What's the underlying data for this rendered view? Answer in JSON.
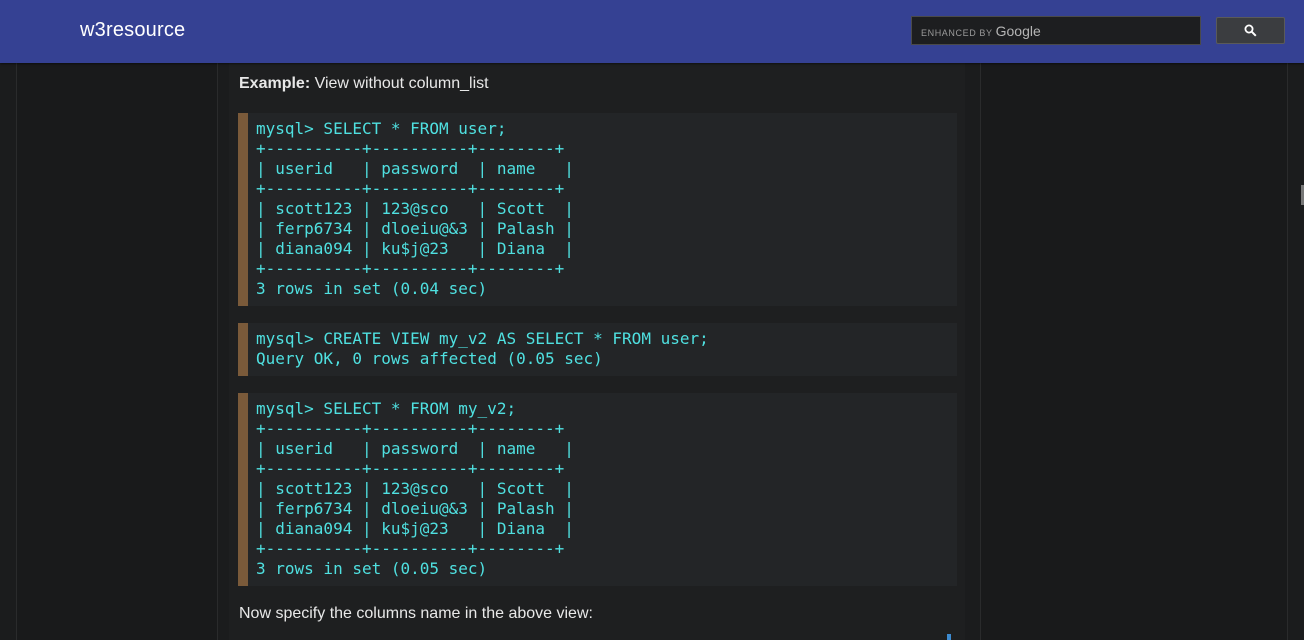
{
  "header": {
    "brand": "w3resource",
    "search": {
      "enhanced_label": "ENHANCED BY",
      "google_label": "Google",
      "value": ""
    }
  },
  "content": {
    "example_label": "Example:",
    "example_text": " View without column_list",
    "blocks": [
      {
        "lines": [
          "mysql> SELECT * FROM user;",
          "+----------+----------+--------+",
          "| userid   | password  | name   |",
          "+----------+----------+--------+",
          "| scott123 | 123@sco   | Scott  |",
          "| ferp6734 | dloeiu@&3 | Palash |",
          "| diana094 | ku$j@23   | Diana  |",
          "+----------+----------+--------+",
          "3 rows in set (0.04 sec)"
        ]
      },
      {
        "lines": [
          "mysql> CREATE VIEW my_v2 AS SELECT * FROM user;",
          "Query OK, 0 rows affected (0.05 sec)"
        ]
      },
      {
        "lines": [
          "mysql> SELECT * FROM my_v2;",
          "+----------+----------+--------+",
          "| userid   | password  | name   |",
          "+----------+----------+--------+",
          "| scott123 | 123@sco   | Scott  |",
          "| ferp6734 | dloeiu@&3 | Palash |",
          "| diana094 | ku$j@23   | Diana  |",
          "+----------+----------+--------+",
          "3 rows in set (0.05 sec)"
        ]
      }
    ],
    "footer_text": "Now specify the columns name in the above view:"
  },
  "colors": {
    "header_bg": "#354193",
    "code_text": "#4fe0e0",
    "code_border": "#7a5a3a"
  }
}
